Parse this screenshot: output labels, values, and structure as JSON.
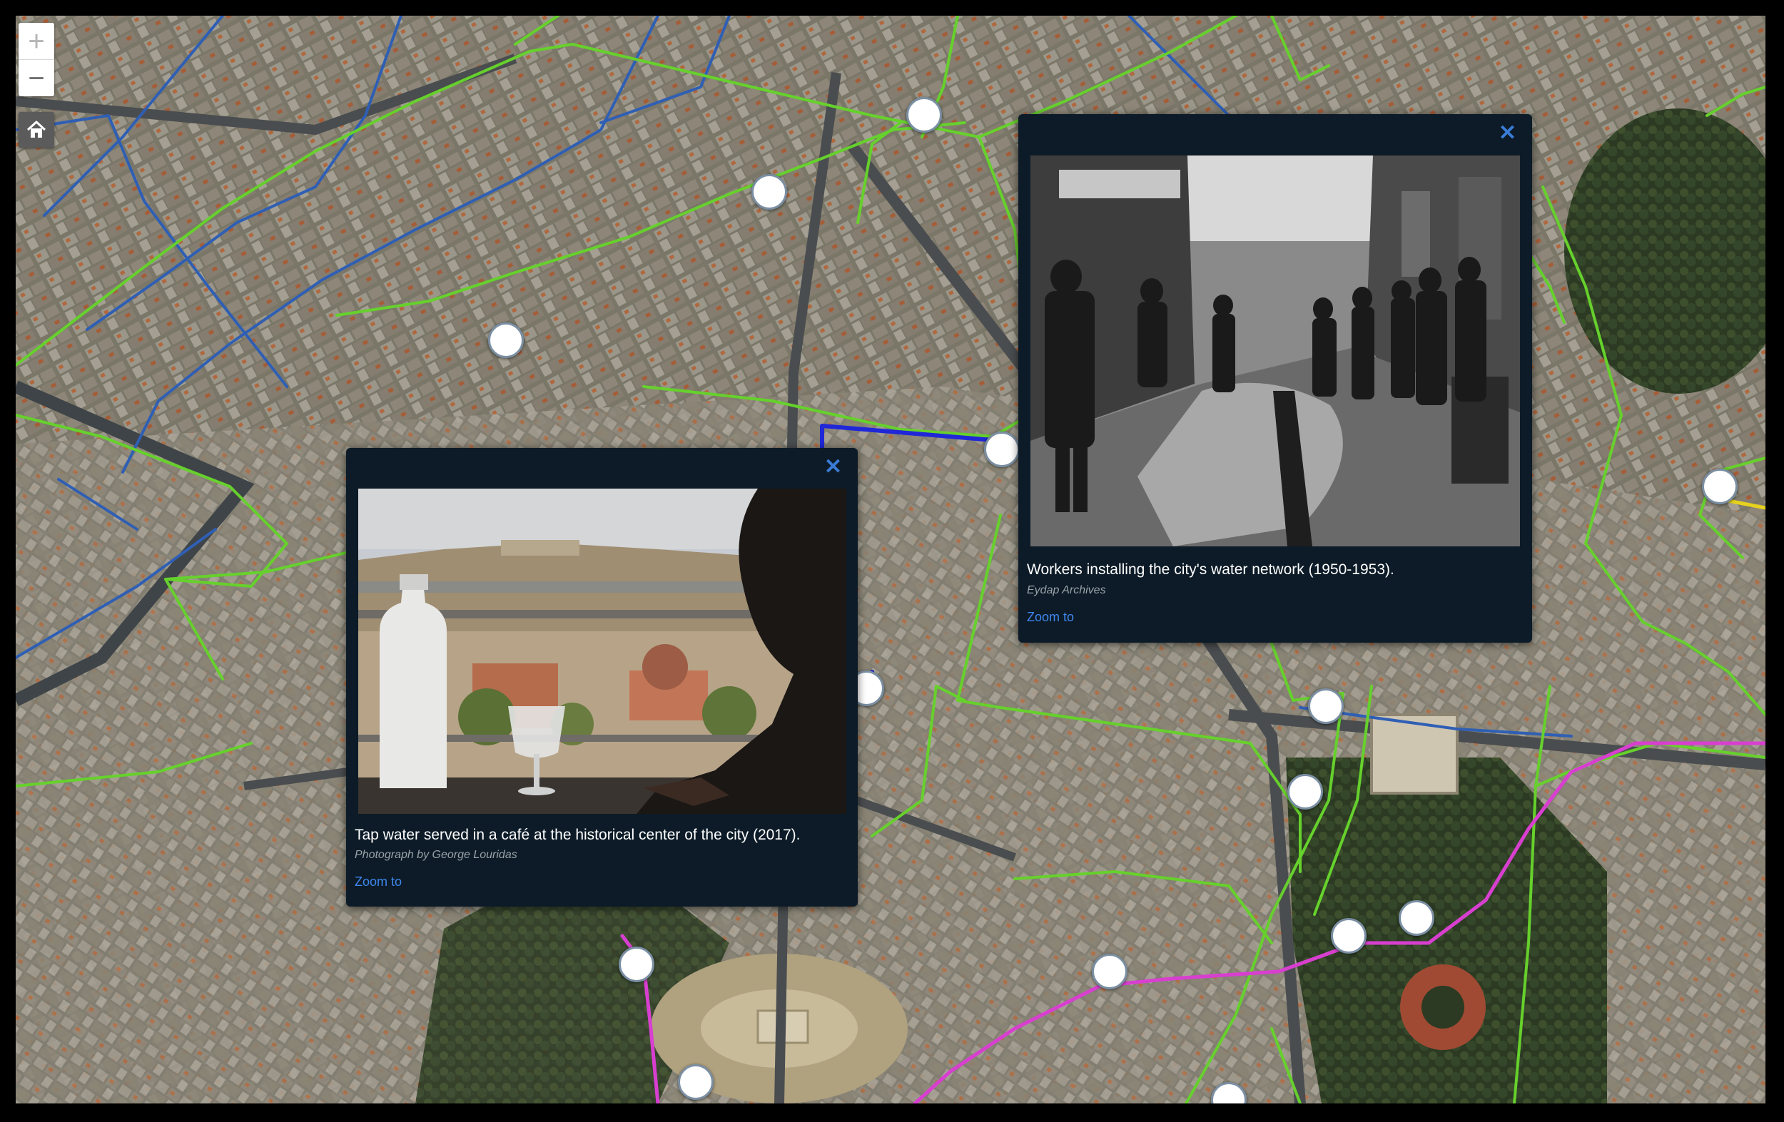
{
  "map": {
    "controls": {
      "zoom_in_label": "+",
      "zoom_out_label": "−",
      "home_icon": "home-icon"
    },
    "pipe_colors": {
      "green": "#66d12c",
      "blue": "#2f5fb4",
      "dark_blue": "#1f27d8",
      "magenta": "#d83fd0",
      "yellow": "#e6d21e"
    },
    "marker_count": 17
  },
  "popups": [
    {
      "caption": "Tap water served in a café at the historical center of the city (2017).",
      "credit": "Photograph by George Louridas",
      "zoom_label": "Zoom to",
      "close_icon": "close-icon"
    },
    {
      "caption": "Workers installing the city's water network (1950-1953).",
      "credit": "Eydap Archives",
      "zoom_label": "Zoom to",
      "close_icon": "close-icon"
    }
  ]
}
